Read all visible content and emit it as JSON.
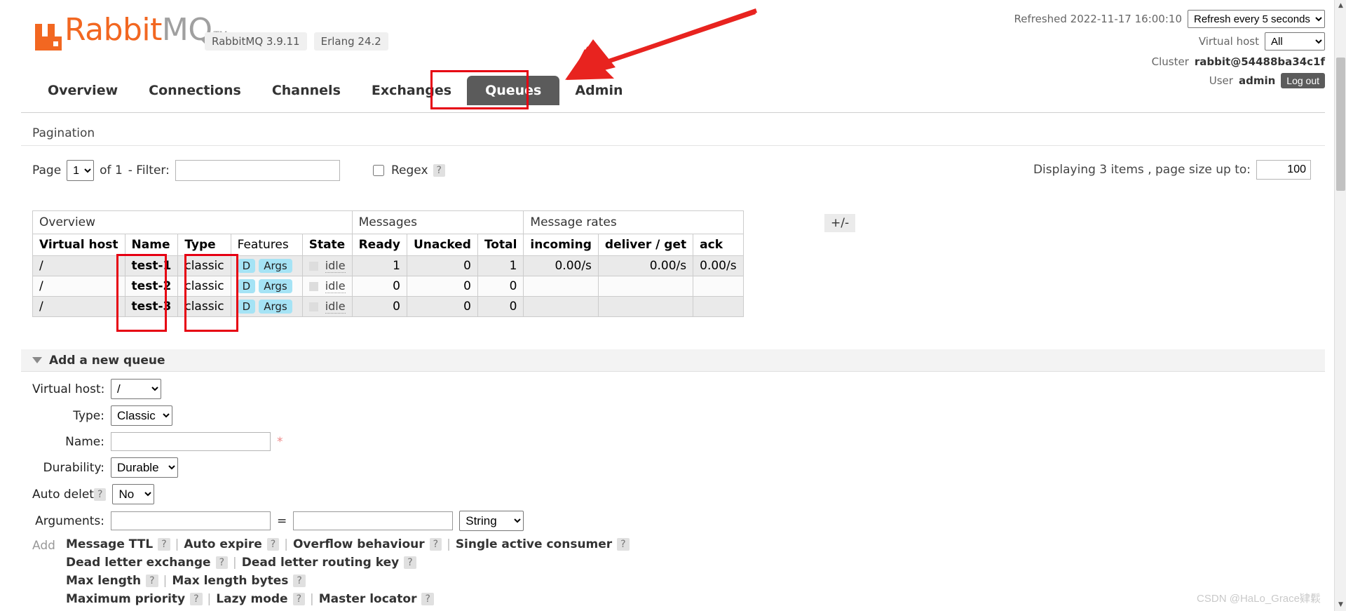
{
  "brand": {
    "name_part1": "Rabbit",
    "name_part2": "MQ",
    "tm": "TM",
    "logo_color": "#f26721"
  },
  "header": {
    "badges": [
      "RabbitMQ 3.9.11",
      "Erlang 24.2"
    ],
    "refreshed_label": "Refreshed 2022-11-17 16:00:10",
    "refresh_select_value": "Refresh every 5 seconds",
    "refresh_options": [
      "Refresh every 5 seconds"
    ],
    "vhost_label": "Virtual host",
    "vhost_value": "All",
    "vhost_options": [
      "All"
    ],
    "cluster_label": "Cluster",
    "cluster_value": "rabbit@54488ba34c1f",
    "user_label": "User",
    "user_value": "admin",
    "logout_label": "Log out"
  },
  "nav": {
    "items": [
      {
        "label": "Overview",
        "selected": false
      },
      {
        "label": "Connections",
        "selected": false
      },
      {
        "label": "Channels",
        "selected": false
      },
      {
        "label": "Exchanges",
        "selected": false
      },
      {
        "label": "Queues",
        "selected": true
      },
      {
        "label": "Admin",
        "selected": false
      }
    ]
  },
  "pagination": {
    "section_title": "Pagination",
    "page_label": "Page",
    "page_value": "1",
    "page_options": [
      "1"
    ],
    "of_label": "of 1",
    "filter_label": "- Filter:",
    "filter_value": "",
    "regex_label": "Regex",
    "regex_help": "?",
    "regex_checked": false,
    "displaying_text": "Displaying 3 items , page size up to:",
    "page_size_value": "100"
  },
  "queues_table": {
    "group_headers": [
      {
        "label": "Overview",
        "span": 5
      },
      {
        "label": "Messages",
        "span": 3
      },
      {
        "label": "Message rates",
        "span": 3
      }
    ],
    "columns": [
      {
        "label": "Virtual host",
        "bold": true
      },
      {
        "label": "Name",
        "bold": true
      },
      {
        "label": "Type",
        "bold": true
      },
      {
        "label": "Features",
        "bold": false
      },
      {
        "label": "State",
        "bold": true
      },
      {
        "label": "Ready",
        "bold": true
      },
      {
        "label": "Unacked",
        "bold": true
      },
      {
        "label": "Total",
        "bold": true
      },
      {
        "label": "incoming",
        "bold": true
      },
      {
        "label": "deliver / get",
        "bold": true
      },
      {
        "label": "ack",
        "bold": true
      }
    ],
    "plus_minus": "+/-",
    "rows": [
      {
        "vhost": "/",
        "name": "test-1",
        "type": "classic",
        "features": [
          "D",
          "Args"
        ],
        "state": "idle",
        "ready": "1",
        "unacked": "0",
        "total": "1",
        "incoming": "0.00/s",
        "deliver_get": "0.00/s",
        "ack": "0.00/s"
      },
      {
        "vhost": "/",
        "name": "test-2",
        "type": "classic",
        "features": [
          "D",
          "Args"
        ],
        "state": "idle",
        "ready": "0",
        "unacked": "0",
        "total": "0",
        "incoming": "",
        "deliver_get": "",
        "ack": ""
      },
      {
        "vhost": "/",
        "name": "test-3",
        "type": "classic",
        "features": [
          "D",
          "Args"
        ],
        "state": "idle",
        "ready": "0",
        "unacked": "0",
        "total": "0",
        "incoming": "",
        "deliver_get": "",
        "ack": ""
      }
    ]
  },
  "add_queue": {
    "title": "Add a new queue",
    "vhost_label": "Virtual host:",
    "vhost_value": "/",
    "vhost_options": [
      "/"
    ],
    "type_label": "Type:",
    "type_value": "Classic",
    "type_options": [
      "Classic"
    ],
    "name_label": "Name:",
    "name_value": "",
    "name_required_mark": "*",
    "durability_label": "Durability:",
    "durability_value": "Durable",
    "durability_options": [
      "Durable"
    ],
    "autodelete_label": "Auto delete:",
    "autodelete_help": "?",
    "autodelete_value": "No",
    "autodelete_options": [
      "No"
    ],
    "arguments_label": "Arguments:",
    "arg_key_value": "",
    "arg_val_value": "",
    "arg_equals": "=",
    "arg_type_value": "String",
    "arg_type_options": [
      "String"
    ],
    "add_label": "Add",
    "preset_rows": [
      [
        {
          "label": "Message TTL",
          "help": "?"
        },
        {
          "label": "Auto expire",
          "help": "?"
        },
        {
          "label": "Overflow behaviour",
          "help": "?"
        },
        {
          "label": "Single active consumer",
          "help": "?"
        }
      ],
      [
        {
          "label": "Dead letter exchange",
          "help": "?"
        },
        {
          "label": "Dead letter routing key",
          "help": "?"
        }
      ],
      [
        {
          "label": "Max length",
          "help": "?"
        },
        {
          "label": "Max length bytes",
          "help": "?"
        }
      ],
      [
        {
          "label": "Maximum priority",
          "help": "?"
        },
        {
          "label": "Lazy mode",
          "help": "?"
        },
        {
          "label": "Master locator",
          "help": "?"
        }
      ]
    ]
  },
  "watermark": "CSDN @HaLo_Grace肄鬏",
  "annotations": {
    "arrow_color": "#e60012",
    "highlight_color": "#e60012"
  }
}
